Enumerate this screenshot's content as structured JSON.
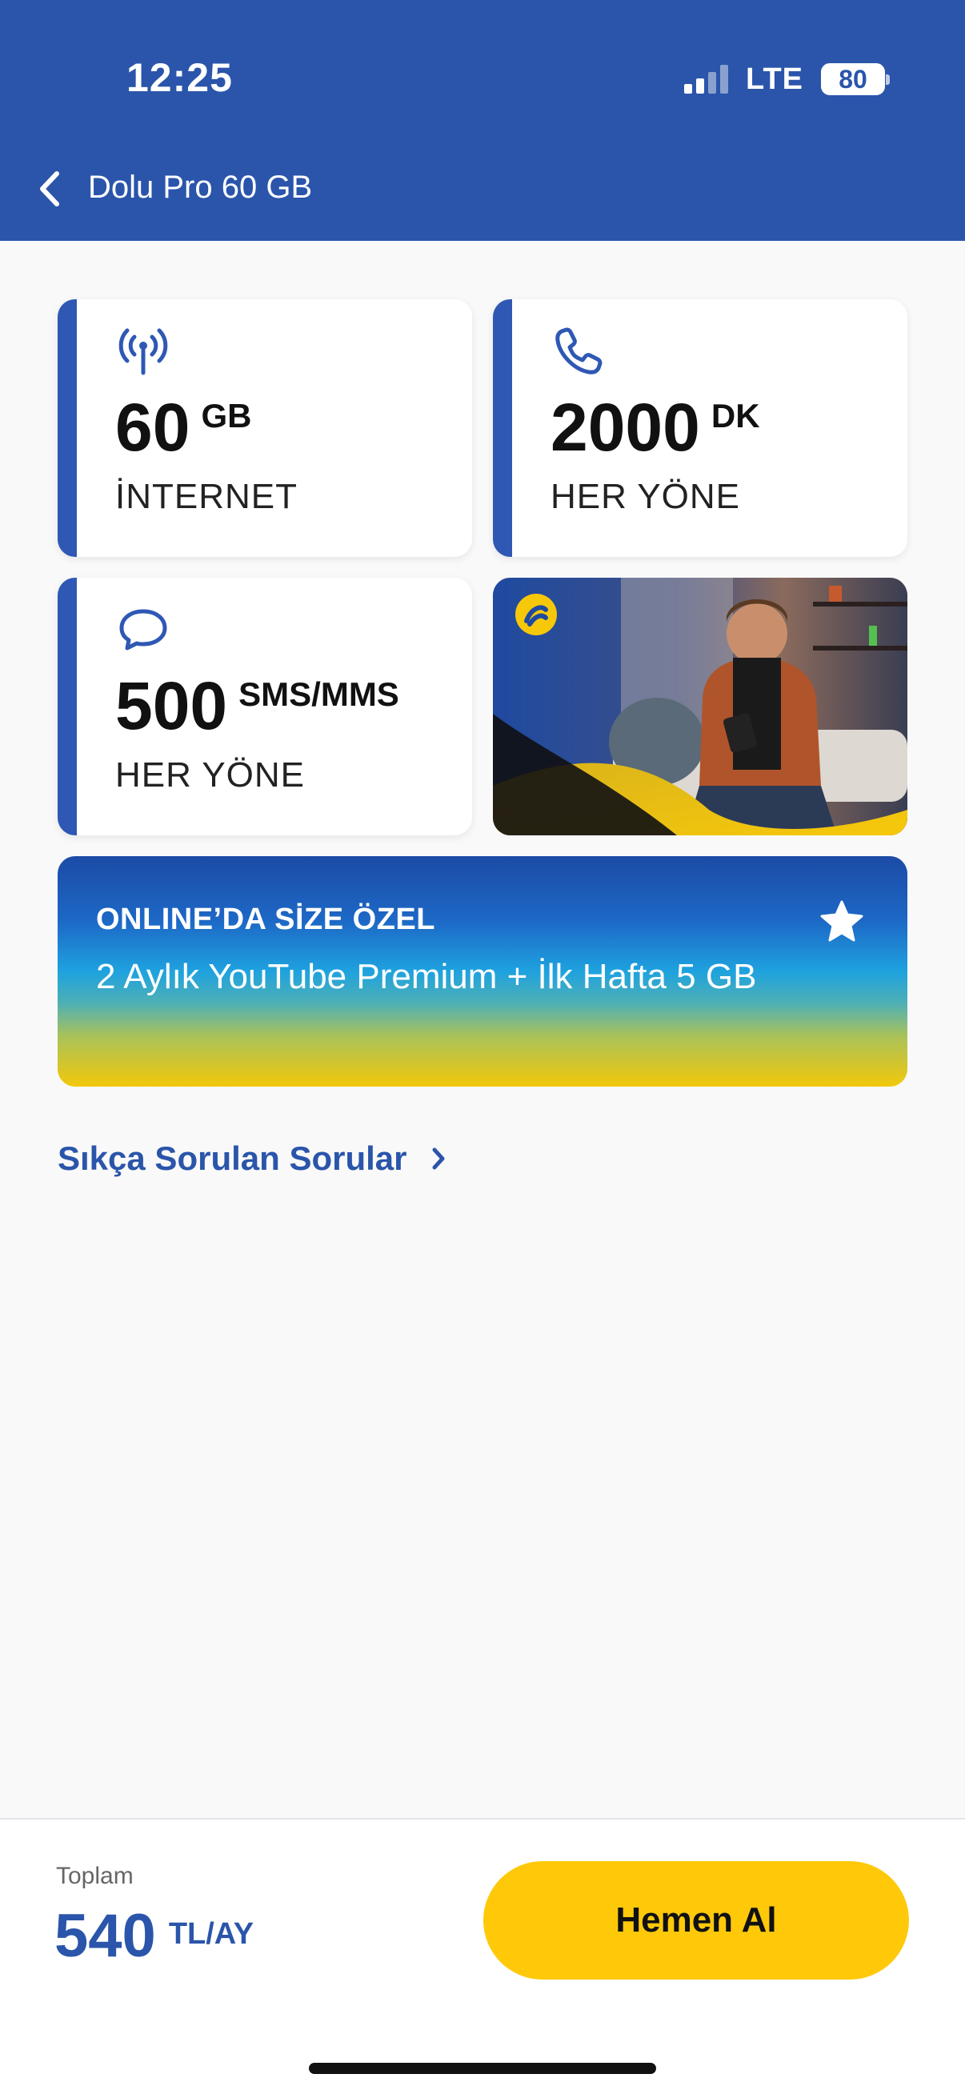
{
  "status_bar": {
    "time": "12:25",
    "network": "LTE",
    "battery": "80",
    "signal_bars": 4,
    "signal_active": 2
  },
  "header": {
    "title": "Dolu Pro 60 GB",
    "back_icon": "chevron-left-icon"
  },
  "cards": {
    "internet": {
      "icon": "antenna-icon",
      "amount": "60",
      "unit": "GB",
      "label": "İNTERNET"
    },
    "minutes": {
      "icon": "phone-icon",
      "amount": "2000",
      "unit": "DK",
      "label": "HER YÖNE"
    },
    "sms": {
      "icon": "chat-bubble-icon",
      "amount": "500",
      "unit": "SMS/MMS",
      "label": "HER YÖNE"
    }
  },
  "promo": {
    "title": "ONLINE’DA SİZE ÖZEL",
    "text": "2 Aylık YouTube Premium + İlk Hafta 5 GB",
    "icon": "star-icon"
  },
  "faq": {
    "label": "Sıkça Sorulan Sorular",
    "icon": "chevron-right-icon"
  },
  "footer": {
    "total_label": "Toplam",
    "price": "540",
    "price_unit": "TL/AY",
    "buy_label": "Hemen Al"
  },
  "colors": {
    "brand_blue": "#2a55aa",
    "accent_yellow": "#ffc90a",
    "background": "#f9f9f9"
  }
}
